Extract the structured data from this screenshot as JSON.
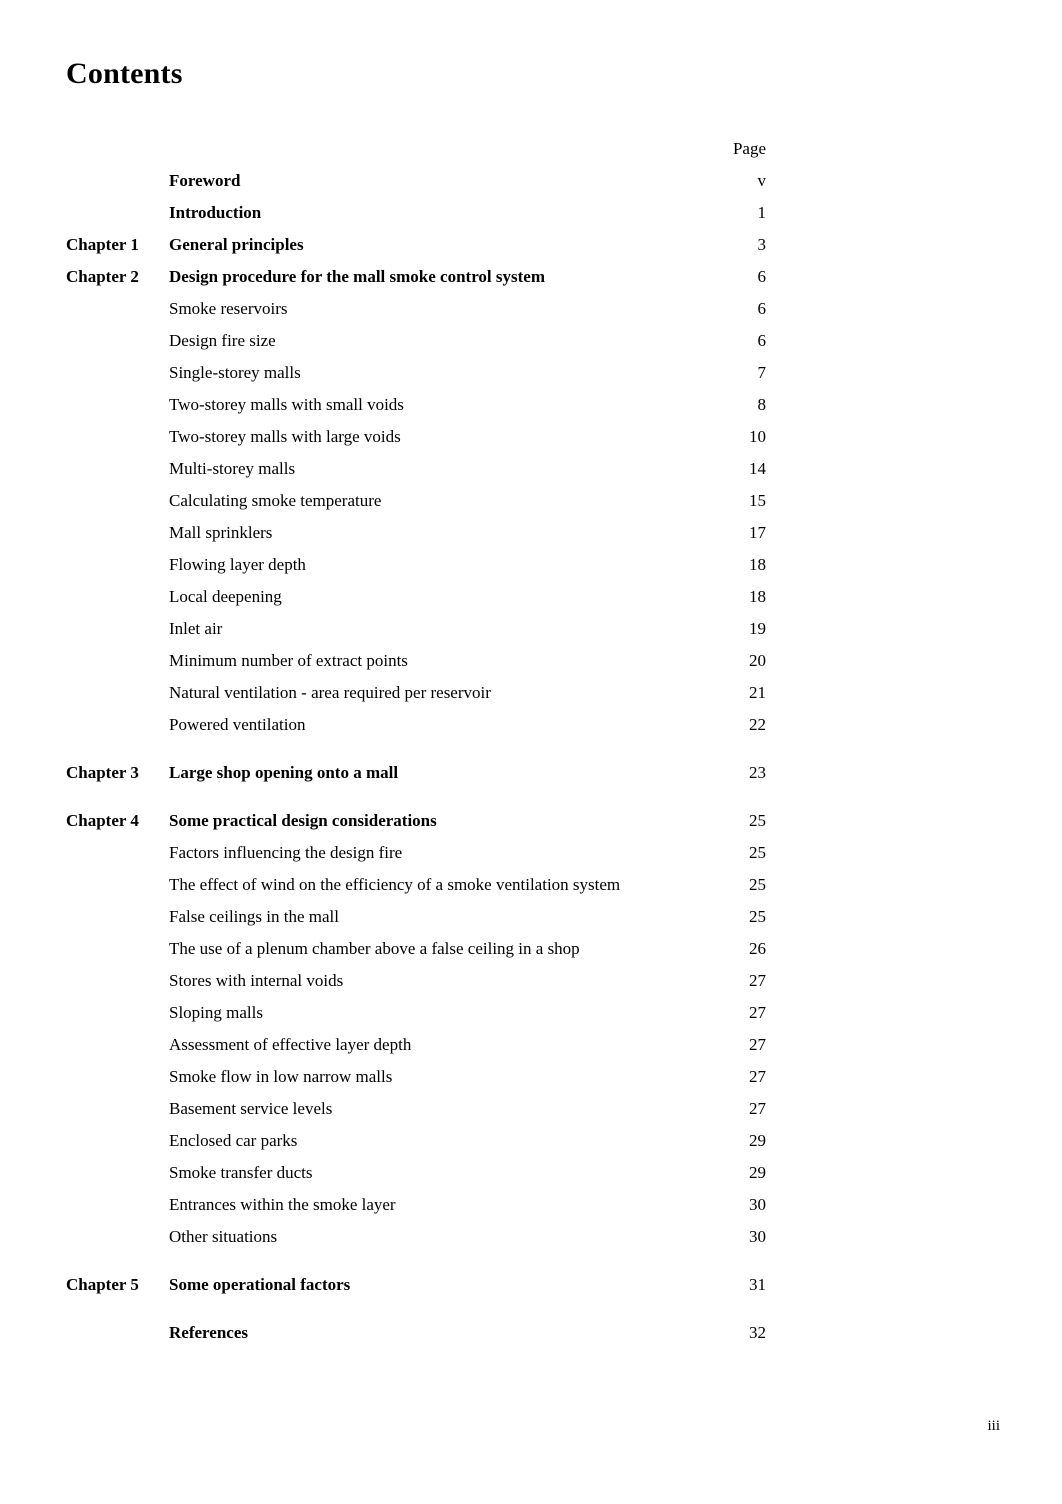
{
  "document": {
    "title": "Contents",
    "folio": "iii"
  },
  "table_header": {
    "page_column": "Page"
  },
  "entries": [
    {
      "chapter": "",
      "title": "Foreword",
      "page": "v",
      "level": "bold",
      "gap_before": false
    },
    {
      "chapter": "",
      "title": "Introduction",
      "page": "1",
      "level": "bold",
      "gap_before": false
    },
    {
      "chapter": "Chapter 1",
      "title": "General principles",
      "page": "3",
      "level": "bold",
      "gap_before": false
    },
    {
      "chapter": "Chapter 2",
      "title": "Design procedure for the mall smoke control system",
      "page": "6",
      "level": "bold",
      "gap_before": false
    },
    {
      "chapter": "",
      "title": "Smoke reservoirs",
      "page": "6",
      "level": "sub",
      "gap_before": false
    },
    {
      "chapter": "",
      "title": "Design fire size",
      "page": "6",
      "level": "sub",
      "gap_before": false
    },
    {
      "chapter": "",
      "title": "Single-storey malls",
      "page": "7",
      "level": "sub",
      "gap_before": false
    },
    {
      "chapter": "",
      "title": "Two-storey malls with small voids",
      "page": "8",
      "level": "sub",
      "gap_before": false
    },
    {
      "chapter": "",
      "title": "Two-storey malls with large voids",
      "page": "10",
      "level": "sub",
      "gap_before": false
    },
    {
      "chapter": "",
      "title": "Multi-storey malls",
      "page": "14",
      "level": "sub",
      "gap_before": false
    },
    {
      "chapter": "",
      "title": "Calculating smoke temperature",
      "page": "15",
      "level": "sub",
      "gap_before": false
    },
    {
      "chapter": "",
      "title": "Mall sprinklers",
      "page": "17",
      "level": "sub",
      "gap_before": false
    },
    {
      "chapter": "",
      "title": "Flowing layer depth",
      "page": "18",
      "level": "sub",
      "gap_before": false
    },
    {
      "chapter": "",
      "title": "Local deepening",
      "page": "18",
      "level": "sub",
      "gap_before": false
    },
    {
      "chapter": "",
      "title": "Inlet air",
      "page": "19",
      "level": "sub",
      "gap_before": false
    },
    {
      "chapter": "",
      "title": "Minimum number of extract points",
      "page": "20",
      "level": "sub",
      "gap_before": false
    },
    {
      "chapter": "",
      "title": "Natural ventilation - area required per reservoir",
      "page": "21",
      "level": "sub",
      "gap_before": false
    },
    {
      "chapter": "",
      "title": "Powered ventilation",
      "page": "22",
      "level": "sub",
      "gap_before": false
    },
    {
      "chapter": "Chapter 3",
      "title": "Large shop opening onto a mall",
      "page": "23",
      "level": "bold",
      "gap_before": true
    },
    {
      "chapter": "Chapter 4",
      "title": "Some practical design considerations",
      "page": "25",
      "level": "bold",
      "gap_before": true
    },
    {
      "chapter": "",
      "title": "Factors influencing the design fire",
      "page": "25",
      "level": "sub",
      "gap_before": false
    },
    {
      "chapter": "",
      "title": "The effect of wind on the efficiency of a smoke ventilation system",
      "page": "25",
      "level": "sub",
      "gap_before": false
    },
    {
      "chapter": "",
      "title": "False ceilings in the mall",
      "page": "25",
      "level": "sub",
      "gap_before": false
    },
    {
      "chapter": "",
      "title": "The use of a plenum chamber above a false ceiling in a shop",
      "page": "26",
      "level": "sub",
      "gap_before": false
    },
    {
      "chapter": "",
      "title": "Stores with internal voids",
      "page": "27",
      "level": "sub",
      "gap_before": false
    },
    {
      "chapter": "",
      "title": "Sloping malls",
      "page": "27",
      "level": "sub",
      "gap_before": false
    },
    {
      "chapter": "",
      "title": "Assessment of effective layer depth",
      "page": "27",
      "level": "sub",
      "gap_before": false
    },
    {
      "chapter": "",
      "title": "Smoke flow in low narrow malls",
      "page": "27",
      "level": "sub",
      "gap_before": false
    },
    {
      "chapter": "",
      "title": "Basement service levels",
      "page": "27",
      "level": "sub",
      "gap_before": false
    },
    {
      "chapter": "",
      "title": "Enclosed car parks",
      "page": "29",
      "level": "sub",
      "gap_before": false
    },
    {
      "chapter": "",
      "title": "Smoke transfer ducts",
      "page": "29",
      "level": "sub",
      "gap_before": false
    },
    {
      "chapter": "",
      "title": "Entrances within the smoke layer",
      "page": "30",
      "level": "sub",
      "gap_before": false
    },
    {
      "chapter": "",
      "title": "Other situations",
      "page": "30",
      "level": "sub",
      "gap_before": false
    },
    {
      "chapter": "Chapter 5",
      "title": "Some operational factors",
      "page": "31",
      "level": "bold",
      "gap_before": true
    },
    {
      "chapter": "",
      "title": "References",
      "page": "32",
      "level": "bold",
      "gap_before": true
    }
  ]
}
